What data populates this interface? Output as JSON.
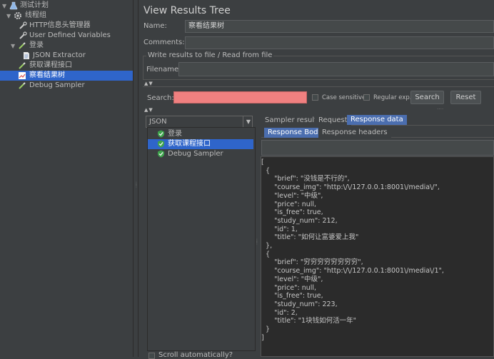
{
  "tree": {
    "plan": "测试计划",
    "thread_group": "线程组",
    "http_header": "HTTP信息头管理器",
    "udv": "User Defined Variables",
    "login": "登录",
    "json_extractor": "JSON Extractor",
    "get_course": "获取课程接口",
    "view_results": "察看结果树",
    "debug": "Debug Sampler"
  },
  "panel": {
    "title": "View Results Tree",
    "name_label": "Name:",
    "name_value": "察看结果树",
    "comments_label": "Comments:",
    "write_legend": "Write results to file / Read from file",
    "filename_label": "Filename"
  },
  "search": {
    "label": "Search:",
    "case_sensitive": "Case sensitive",
    "regular_exp": "Regular exp.",
    "search_button": "Search",
    "reset_button": "Reset"
  },
  "renderer": {
    "selected": "JSON"
  },
  "samples": [
    "登录",
    "获取课程接口",
    "Debug Sampler"
  ],
  "tabs": {
    "sampler_result": "Sampler result",
    "request": "Request",
    "response_data": "Response data",
    "response_body": "Response Body",
    "response_headers": "Response headers"
  },
  "response_text": "[\n  {\n      \"brief\": \"没钱是不行的\",\n      \"course_img\": \"http:\\/\\/127.0.0.1:8001\\/media\\/\",\n      \"level\": \"中级\",\n      \"price\": null,\n      \"is_free\": true,\n      \"study_num\": 212,\n      \"id\": 1,\n      \"title\": \"如何让富婆爱上我\"\n  },\n  {\n      \"brief\": \"穷穷穷穷穷穷穷穷\",\n      \"course_img\": \"http:\\/\\/127.0.0.1:8001\\/media\\/1\",\n      \"level\": \"中级\",\n      \"price\": null,\n      \"is_free\": true,\n      \"study_num\": 223,\n      \"id\": 2,\n      \"title\": \"1块钱如何活一年\"\n  }\n]",
  "scroll_auto": "Scroll automatically?"
}
